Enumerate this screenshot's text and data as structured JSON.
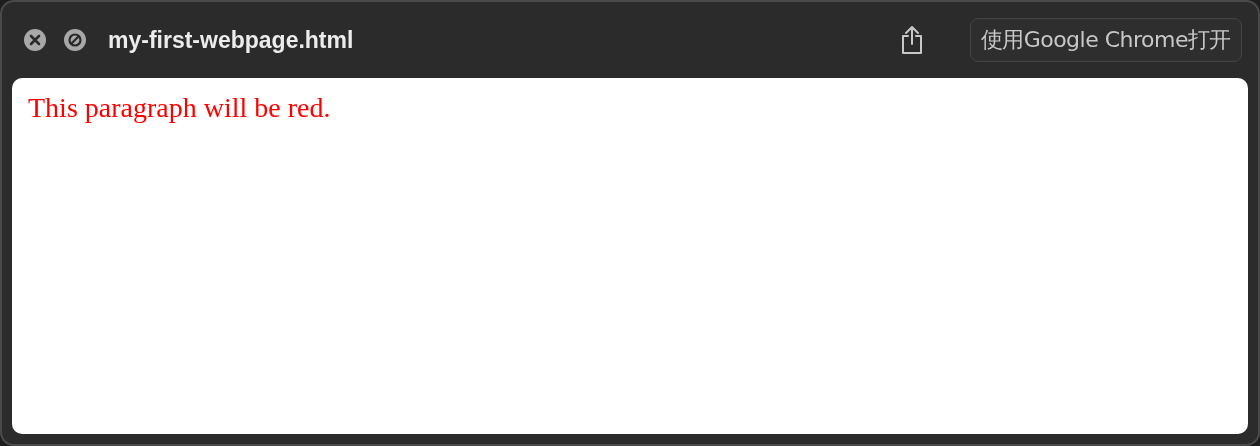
{
  "window": {
    "title": "my-first-webpage.html"
  },
  "toolbar": {
    "open_button": "使用Google Chrome打开"
  },
  "content": {
    "paragraphs": [
      {
        "text": "This paragraph will be red.",
        "color": "#ff0000"
      }
    ]
  }
}
